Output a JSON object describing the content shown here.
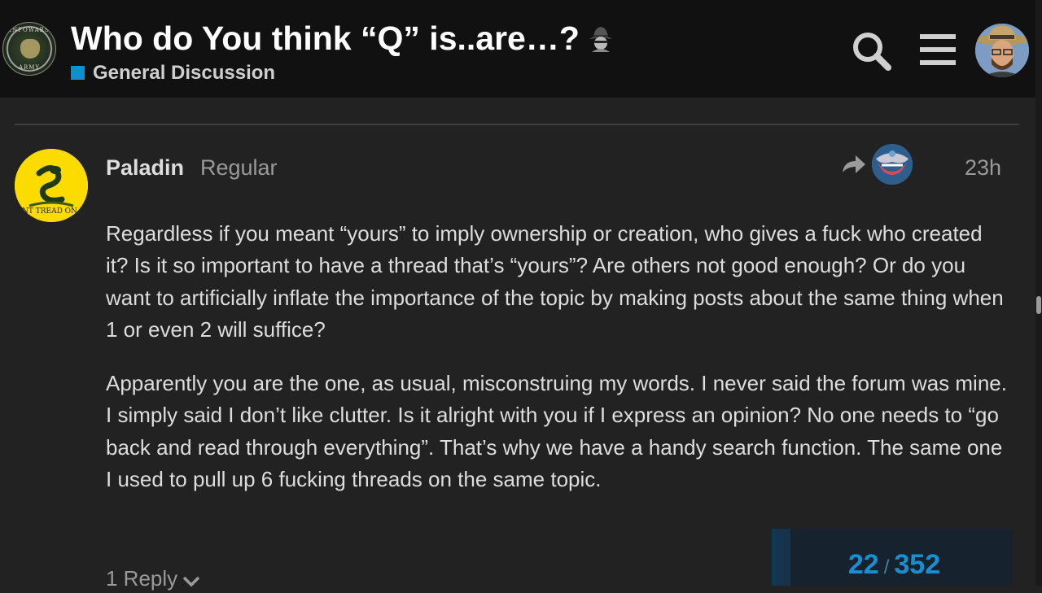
{
  "header": {
    "logo_text_top": "INFOWARS",
    "logo_text_bottom": "ARMY",
    "topic_title": "Who do You think “Q” is..are…?",
    "title_emoji": "detective-emoji",
    "category": "General Discussion",
    "category_color": "#0e8fd1",
    "search_icon": "search-icon",
    "menu_icon": "hamburger-menu-icon"
  },
  "post": {
    "username": "Paladin",
    "user_title": "Regular",
    "date": "23h",
    "avatar_text": "DONT TREAD ON ME",
    "paragraphs": [
      "Regardless if you meant “yours” to imply ownership or creation, who gives a fuck who created it? Is it so important to have a thread that’s “yours”? Are others not good enough? Or do you want to artificially inflate the importance of the topic by making posts about the same thing when 1 or even 2 will suffice?",
      "Apparently you are the one, as usual, misconstruing my words. I never said the forum was mine. I simply said I don’t like clutter. Is it alright with you if I express an opinion? No one needs to “go back and read through everything”. That’s why we have a handy search function. The same one I used to pull up 6 fucking threads on the same topic."
    ],
    "replies_label": "1 Reply"
  },
  "timeline": {
    "current": "22",
    "separator": "/",
    "total": "352",
    "progress": 0.0625
  }
}
